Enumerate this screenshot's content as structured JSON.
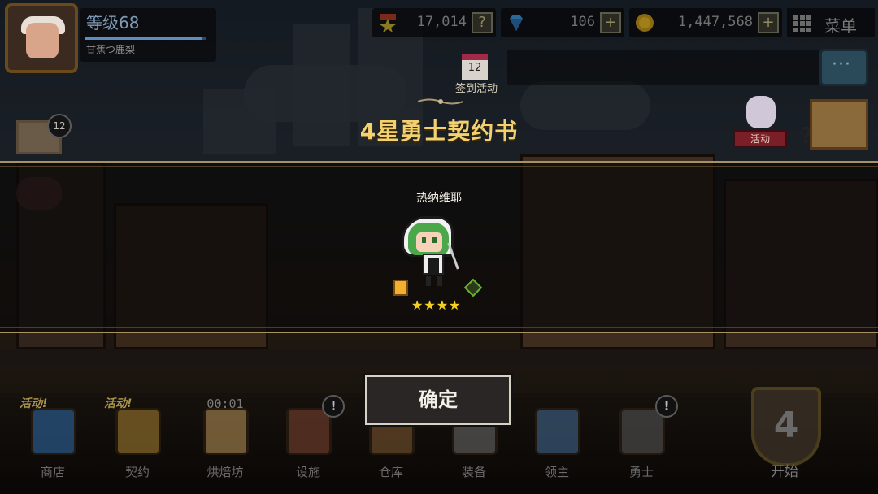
{
  "player": {
    "level_label": "等级68",
    "name": "甘蕉つ鹿梨",
    "exp_fraction": 0.96
  },
  "resources": [
    {
      "name": "honor",
      "icon": "star-medal-icon",
      "value": "17,014",
      "button": "?"
    },
    {
      "name": "gems",
      "icon": "diamond-icon",
      "value": "106",
      "button": "+"
    },
    {
      "name": "gold",
      "icon": "gold-coin-icon",
      "value": "1,447,568",
      "button": "+"
    }
  ],
  "menu_label": "菜单",
  "checkin": {
    "day": "12",
    "label": "签到活动"
  },
  "mail_count": "12",
  "event_label": "活动",
  "modal": {
    "title": "4星勇士契约书",
    "hero_name": "热纳维耶",
    "stars": "★★★★",
    "star_count": 4,
    "confirm_label": "确定"
  },
  "nav": [
    {
      "id": "shop",
      "label": "商店",
      "tag": "活动!",
      "icon": "shop-gem-icon",
      "color": "#2a5a8a"
    },
    {
      "id": "contract",
      "label": "契约",
      "tag": "活动!",
      "icon": "contract-hand-icon",
      "color": "#8a6a2a"
    },
    {
      "id": "bakery",
      "label": "烘焙坊",
      "timer": "00:01",
      "icon": "bread-icon",
      "color": "#9a7a4a"
    },
    {
      "id": "facilities",
      "label": "设施",
      "alert": "!",
      "icon": "building-icon",
      "color": "#6a3a2a"
    },
    {
      "id": "warehouse",
      "label": "仓库",
      "icon": "crate-icon",
      "color": "#6a4a2a"
    },
    {
      "id": "equipment",
      "label": "装备",
      "icon": "axe-icon",
      "color": "#5a5a5a"
    },
    {
      "id": "lord",
      "label": "领主",
      "icon": "helmet-shield-icon",
      "color": "#3a5a7a"
    },
    {
      "id": "heroes",
      "label": "勇士",
      "alert": "!",
      "icon": "spartan-helmet-icon",
      "color": "#4a4a4a"
    }
  ],
  "start": {
    "label": "开始",
    "stage": "4"
  }
}
